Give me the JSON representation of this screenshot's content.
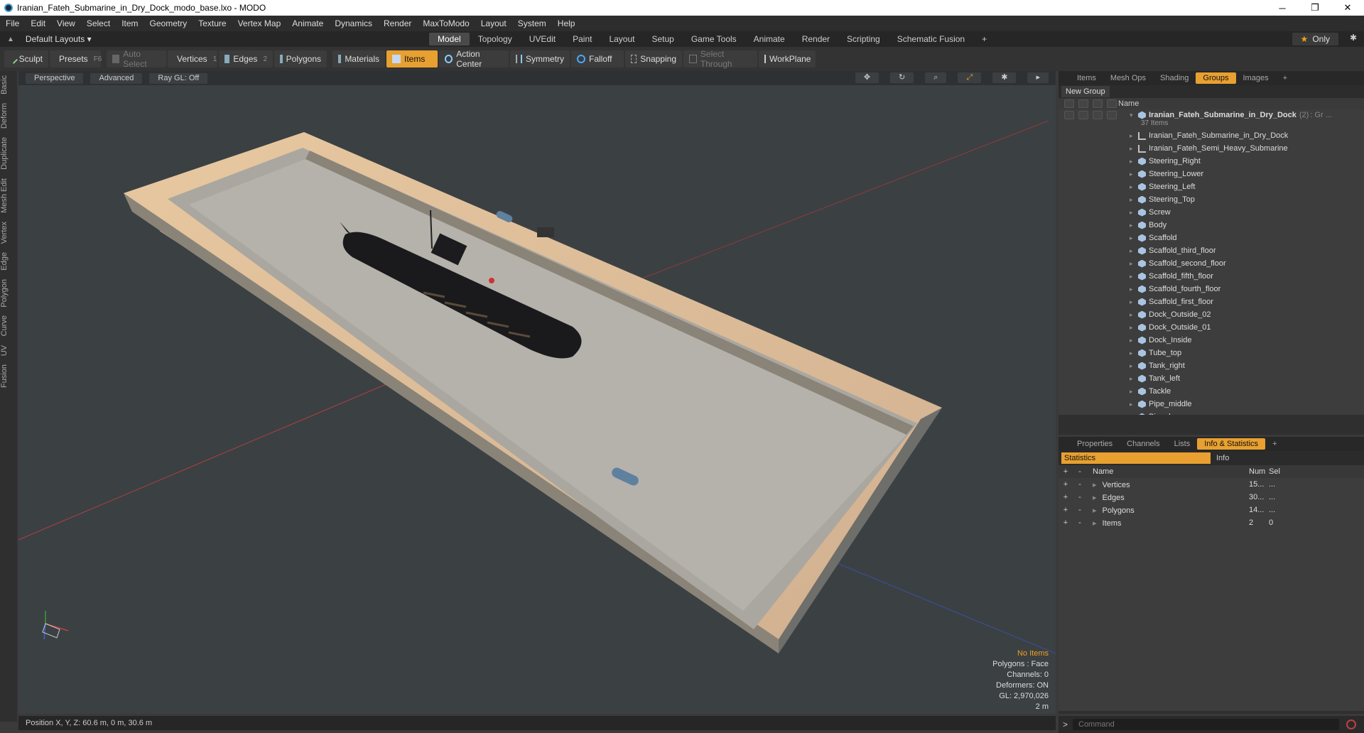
{
  "window": {
    "title": "Iranian_Fateh_Submarine_in_Dry_Dock_modo_base.lxo - MODO",
    "minimize": "─",
    "maximize": "❐",
    "close": "✕"
  },
  "menu": [
    "File",
    "Edit",
    "View",
    "Select",
    "Item",
    "Geometry",
    "Texture",
    "Vertex Map",
    "Animate",
    "Dynamics",
    "Render",
    "MaxToModo",
    "Layout",
    "System",
    "Help"
  ],
  "layout": {
    "name": "Default Layouts ▾",
    "tabs": [
      "Model",
      "Topology",
      "UVEdit",
      "Paint",
      "Layout",
      "Setup",
      "Game Tools",
      "Animate",
      "Render",
      "Scripting",
      "Schematic Fusion",
      "+"
    ],
    "active_tab": "Model",
    "only": "Only",
    "star": "★"
  },
  "toolbar": {
    "sculpt": "Sculpt",
    "presets": "Presets",
    "presets_key": "F6",
    "auto_select": "Auto Select",
    "vertices": "Vertices",
    "vertices_num": "1",
    "edges": "Edges",
    "edges_num": "2",
    "polygons": "Polygons",
    "materials": "Materials",
    "items": "Items",
    "action_center": "Action Center",
    "symmetry": "Symmetry",
    "falloff": "Falloff",
    "snapping": "Snapping",
    "select_through": "Select Through",
    "workplane": "WorkPlane"
  },
  "left_tabs": [
    "Basic",
    "Deform",
    "Duplicate",
    "Mesh Edit",
    "Vertex",
    "Edge",
    "Polygon",
    "Curve",
    "UV",
    "Fusion"
  ],
  "viewport": {
    "view": "Perspective",
    "shading": "Advanced",
    "raygl": "Ray GL: Off",
    "info": {
      "selection": "No Items",
      "polygons": "Polygons : Face",
      "channels": "Channels: 0",
      "deformers": "Deformers: ON",
      "gl": "GL: 2,970,026",
      "scale": "2 m"
    }
  },
  "status": "Position X, Y, Z:  60.6 m, 0 m, 30.6 m",
  "top_panel": {
    "tabs": [
      "Items",
      "Mesh Ops",
      "Shading",
      "Groups",
      "Images",
      "+"
    ],
    "active": "Groups",
    "new_group": "New Group",
    "name_col": "Name",
    "root": {
      "name": "Iranian_Fateh_Submarine_in_Dry_Dock",
      "count": "(2)",
      "suffix": ": Gr ...",
      "items": "37 Items"
    },
    "children": [
      {
        "name": "Iranian_Fateh_Submarine_in_Dry_Dock",
        "kind": "locator"
      },
      {
        "name": "Iranian_Fateh_Semi_Heavy_Submarine",
        "kind": "locator"
      },
      {
        "name": "Steering_Right",
        "kind": "mesh"
      },
      {
        "name": "Steering_Lower",
        "kind": "mesh"
      },
      {
        "name": "Steering_Left",
        "kind": "mesh"
      },
      {
        "name": "Steering_Top",
        "kind": "mesh"
      },
      {
        "name": "Screw",
        "kind": "mesh"
      },
      {
        "name": "Body",
        "kind": "mesh"
      },
      {
        "name": "Scaffold",
        "kind": "mesh"
      },
      {
        "name": "Scaffold_third_floor",
        "kind": "mesh"
      },
      {
        "name": "Scaffold_second_floor",
        "kind": "mesh"
      },
      {
        "name": "Scaffold_fifth_floor",
        "kind": "mesh"
      },
      {
        "name": "Scaffold_fourth_floor",
        "kind": "mesh"
      },
      {
        "name": "Scaffold_first_floor",
        "kind": "mesh"
      },
      {
        "name": "Dock_Outside_02",
        "kind": "mesh"
      },
      {
        "name": "Dock_Outside_01",
        "kind": "mesh"
      },
      {
        "name": "Dock_Inside",
        "kind": "mesh"
      },
      {
        "name": "Tube_top",
        "kind": "mesh"
      },
      {
        "name": "Tank_right",
        "kind": "mesh"
      },
      {
        "name": "Tank_left",
        "kind": "mesh"
      },
      {
        "name": "Tackle",
        "kind": "mesh"
      },
      {
        "name": "Pipe_middle",
        "kind": "mesh"
      },
      {
        "name": "Pipe_lower",
        "kind": "mesh"
      }
    ]
  },
  "bottom_panel": {
    "tabs": [
      "Properties",
      "Channels",
      "Lists",
      "Info & Statistics",
      "+"
    ],
    "active": "Info & Statistics",
    "stat_tab": "Statistics",
    "info_tab": "Info",
    "cols": {
      "name": "Name",
      "num": "Num",
      "sel": "Sel"
    },
    "rows": [
      {
        "name": "Vertices",
        "num": "15...",
        "sel": "..."
      },
      {
        "name": "Edges",
        "num": "30...",
        "sel": "..."
      },
      {
        "name": "Polygons",
        "num": "14...",
        "sel": "..."
      },
      {
        "name": "Items",
        "num": "2",
        "sel": "0"
      }
    ]
  },
  "command": {
    "placeholder": "Command",
    "prompt": ">"
  },
  "colors": {
    "accent": "#e8a030",
    "viewport_bg": "#3b4043"
  }
}
